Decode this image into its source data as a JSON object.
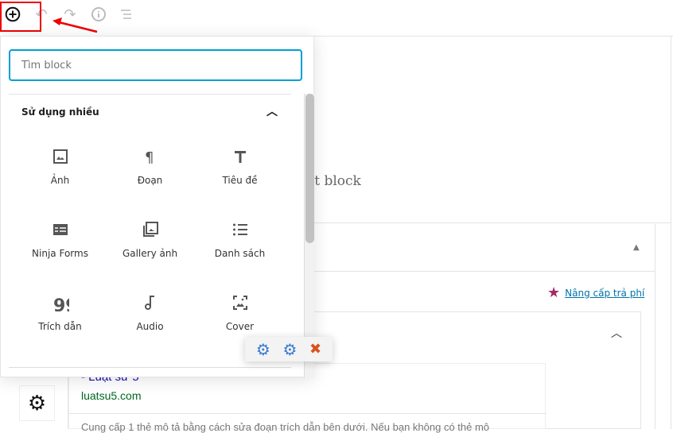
{
  "toolbar": {
    "icons": [
      "add-block-icon",
      "undo-icon",
      "redo-icon",
      "info-icon",
      "outline-icon"
    ]
  },
  "inserter": {
    "search_placeholder": "Tìm block",
    "section_title": "Sử dụng nhiều",
    "blocks": [
      {
        "label": "Ảnh",
        "icon": "image-icon"
      },
      {
        "label": "Đoạn",
        "icon": "paragraph-icon"
      },
      {
        "label": "Tiêu đề",
        "icon": "heading-icon"
      },
      {
        "label": "Ninja Forms",
        "icon": "form-icon"
      },
      {
        "label": "Gallery ảnh",
        "icon": "gallery-icon"
      },
      {
        "label": "Danh sách",
        "icon": "list-icon"
      },
      {
        "label": "Trích dẫn",
        "icon": "quote-icon"
      },
      {
        "label": "Audio",
        "icon": "audio-icon"
      },
      {
        "label": "Cover",
        "icon": "cover-icon"
      }
    ]
  },
  "editor": {
    "placeholder_fragment": "ột block"
  },
  "seo": {
    "upgrade_link": "Nâng cấp trả phí",
    "preview_title": "- Luật sư 5",
    "preview_url": "luatsu5.com",
    "preview_desc": "Cung cấp 1 thẻ mô tả bằng cách sửa đoạn trích dẫn bên dưới. Nếu bạn không có thẻ mô"
  },
  "colors": {
    "accent": "#00a0d2",
    "annotation": "#e00000",
    "star": "#a4286a",
    "link": "#0073aa",
    "url_green": "#006621"
  }
}
